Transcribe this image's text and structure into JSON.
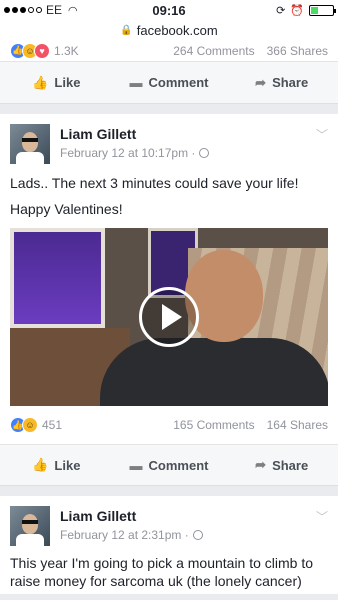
{
  "status_bar": {
    "carrier": "EE",
    "time": "09:16"
  },
  "browser": {
    "url": "facebook.com"
  },
  "top_card": {
    "reaction_count": "1.3K",
    "comments": "264 Comments",
    "shares": "366 Shares"
  },
  "actions": {
    "like": "Like",
    "comment": "Comment",
    "share": "Share"
  },
  "post1": {
    "author": "Liam Gillett",
    "date": "February 12 at 10:17pm ·",
    "text_line1": "Lads.. The next 3 minutes could save your life!",
    "text_line2": "Happy Valentines!",
    "reaction_count": "451",
    "comments": "165 Comments",
    "shares": "164 Shares"
  },
  "post2": {
    "author": "Liam Gillett",
    "date": "February 12 at 2:31pm ·",
    "text": "This year I'm going to pick a mountain to climb to raise money for sarcoma uk (the lonely cancer)"
  },
  "colors": {
    "like_blue": "#4080ff",
    "haha_yellow": "#f7b928",
    "love_red": "#f25268",
    "battery_green": "#4cd964"
  },
  "icons": [
    "signal-icon",
    "wifi-icon",
    "lock-icon",
    "alarm-icon",
    "battery-icon",
    "like-icon",
    "comment-icon",
    "share-icon",
    "globe-icon",
    "chevron-down-icon",
    "play-icon"
  ]
}
